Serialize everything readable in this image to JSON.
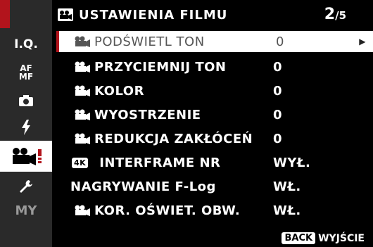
{
  "header": {
    "title": "USTAWIENIA FILMU",
    "page": "2",
    "page_total": "5"
  },
  "sidebar": {
    "items": [
      {
        "label": "I.Q."
      },
      {
        "label_top": "AF",
        "label_bottom": "MF"
      },
      {
        "icon": "camera-icon"
      },
      {
        "icon": "flash-icon"
      },
      {
        "icon": "movie-camera-icon",
        "active": true
      },
      {
        "icon": "wrench-icon"
      },
      {
        "label": "MY"
      }
    ]
  },
  "menu": {
    "rows": [
      {
        "label": "PODŚWIETL TON",
        "value": "0",
        "icon": "movie-camera-icon",
        "selected": true
      },
      {
        "label": "PRZYCIEMNIJ TON",
        "value": "0",
        "icon": "movie-camera-icon"
      },
      {
        "label": "KOLOR",
        "value": "0",
        "icon": "movie-camera-icon"
      },
      {
        "label": "WYOSTRZENIE",
        "value": "0",
        "icon": "movie-camera-icon"
      },
      {
        "label": "REDUKCJA ZAKŁÓCEŃ",
        "value": "0",
        "icon": "movie-camera-icon"
      },
      {
        "label": "INTERFRAME NR",
        "value": "WYŁ.",
        "badge": "4K"
      },
      {
        "label": "NAGRYWANIE F-Log",
        "value": "WŁ."
      },
      {
        "label": "KOR. OŚWIET. OBW.",
        "value": "WŁ.",
        "icon": "movie-camera-icon"
      }
    ]
  },
  "footer": {
    "key": "BACK",
    "label": "WYJŚCIE"
  },
  "colors": {
    "accent_red": "#b2141c",
    "sidebar_bg": "#2a2a2a",
    "background": "#000000"
  }
}
